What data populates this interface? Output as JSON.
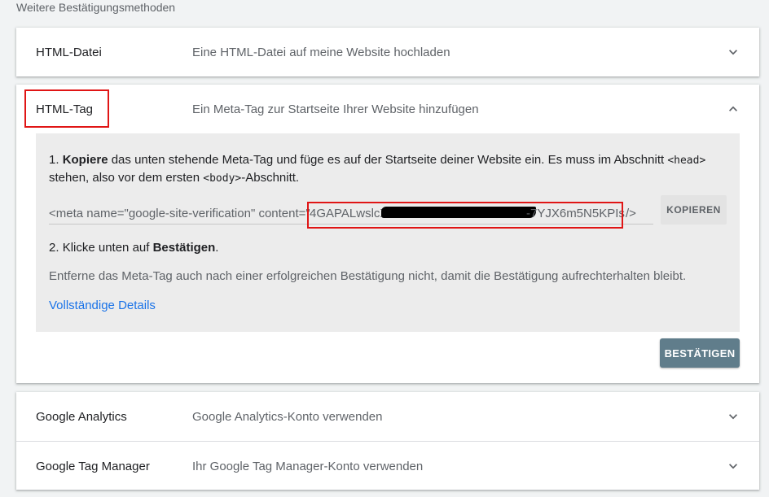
{
  "section_heading": "Weitere Bestätigungsmethoden",
  "methods": [
    {
      "title": "HTML-Datei",
      "description": "Eine HTML-Datei auf meine Website hochladen",
      "expanded": false
    },
    {
      "title": "HTML-Tag",
      "description": "Ein Meta-Tag zur Startseite Ihrer Website hinzufügen",
      "expanded": true
    },
    {
      "title": "Google Analytics",
      "description": "Google Analytics-Konto verwenden",
      "expanded": false
    },
    {
      "title": "Google Tag Manager",
      "description": "Ihr Google Tag Manager-Konto verwenden",
      "expanded": false
    }
  ],
  "html_tag_panel": {
    "step1_num": "1. ",
    "step1_bold": "Kopiere",
    "step1_text_a": " das unten stehende Meta-Tag und füge es auf der Startseite deiner Website ein. Es muss im Abschnitt ",
    "step1_code_head": "<head>",
    "step1_text_b": "stehen, also vor dem ersten ",
    "step1_code_body": "<body>",
    "step1_text_c": "-Abschnitt.",
    "meta_prefix": "<meta name=\"google-site-verification\" content=\"",
    "meta_token_start": "4GAPALwslcX",
    "meta_token_end": "-7YJX6m5N5KPIs",
    "meta_suffix": "/>",
    "copy_label": "KOPIEREN",
    "step2_num": "2. ",
    "step2_text": "Klicke unten auf ",
    "step2_bold": "Bestätigen",
    "step2_end": ".",
    "hint": "Entferne das Meta-Tag auch nach einer erfolgreichen Bestätigung nicht, damit die Bestätigung aufrechterhalten bleibt.",
    "details_link": "Vollständige Details"
  },
  "confirm_label": "BESTÄTIGEN",
  "colors": {
    "highlight_box": "#e01515",
    "confirm_button": "#607d8b",
    "link": "#1a73e8",
    "panel_bg": "#ececec"
  },
  "icons": {
    "collapsed": "chevron-down-icon",
    "expanded": "chevron-up-icon"
  }
}
